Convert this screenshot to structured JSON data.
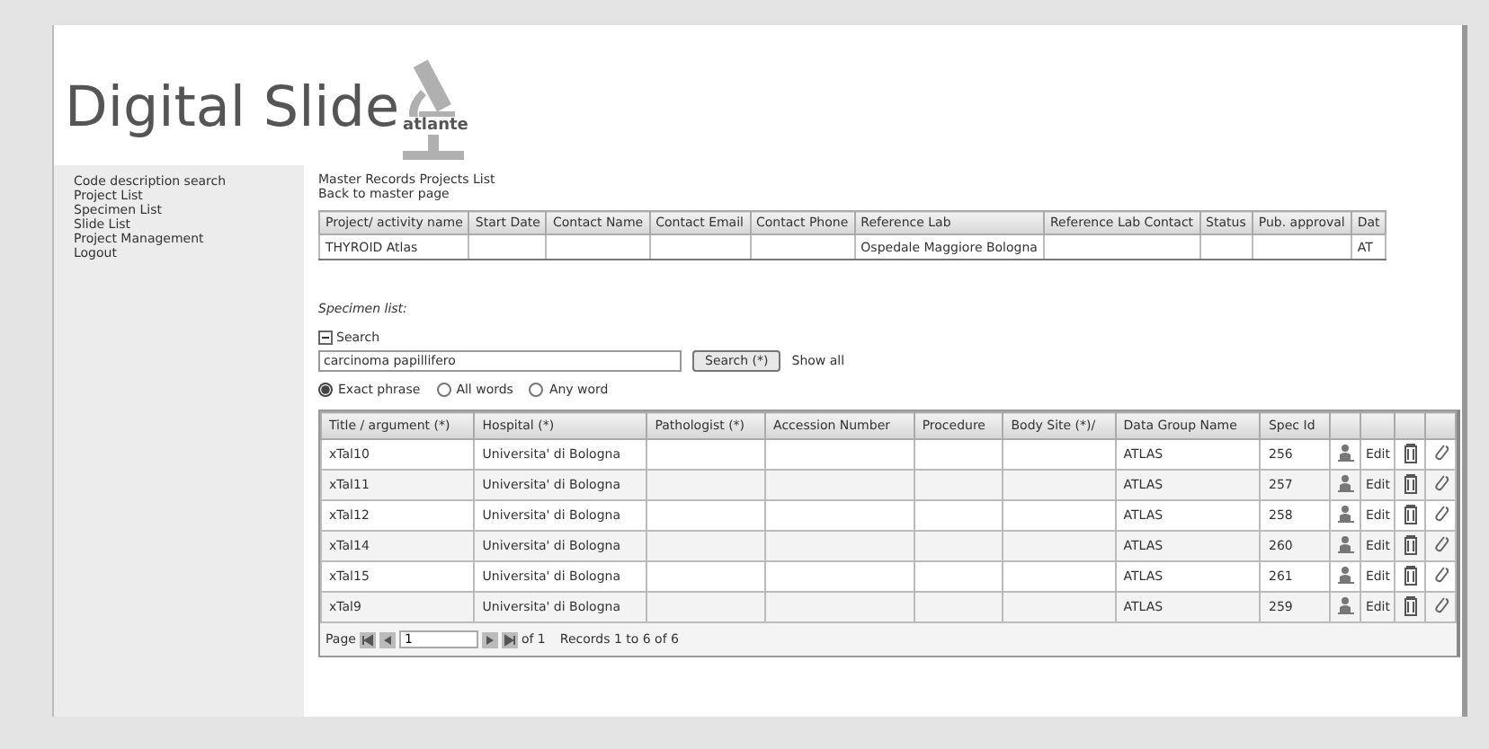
{
  "logo": {
    "title": "Digital Slide",
    "subtitle": "atlante"
  },
  "nav": [
    {
      "label": "Code description search"
    },
    {
      "label": "Project List"
    },
    {
      "label": "Specimen List"
    },
    {
      "label": "Slide List"
    },
    {
      "label": "Project Management"
    },
    {
      "label": "Logout"
    }
  ],
  "master": {
    "title": "Master Records Projects List",
    "back_link": "Back to master page",
    "columns": [
      "Project/ activity name",
      "Start Date",
      "Contact Name",
      "Contact Email",
      "Contact Phone",
      "Reference Lab",
      "Reference Lab Contact",
      "Status",
      "Pub. approval",
      "Dat"
    ],
    "rows": [
      [
        "THYROID Atlas",
        "",
        "",
        "",
        "",
        "Ospedale Maggiore Bologna",
        "",
        "",
        "",
        "AT"
      ]
    ]
  },
  "specimens": {
    "title": "Specimen list:",
    "search": {
      "label": "Search",
      "expanded": true,
      "value": "carcinoma papillifero",
      "button": "Search (*)",
      "show_all": "Show all",
      "options": [
        {
          "label": "Exact phrase",
          "selected": true
        },
        {
          "label": "All words",
          "selected": false
        },
        {
          "label": "Any word",
          "selected": false
        }
      ]
    },
    "columns": [
      "Title / argument (*)",
      "Hospital (*)",
      "Pathologist (*)",
      "Accession Number",
      "Procedure",
      "Body Site (*)/",
      "Data Group Name",
      "Spec Id"
    ],
    "rows": [
      {
        "cells": [
          "xTal10",
          "Universita' di Bologna",
          "",
          "",
          "",
          "",
          "ATLAS",
          "256"
        ],
        "edit": "Edit"
      },
      {
        "cells": [
          "xTal11",
          "Universita' di Bologna",
          "",
          "",
          "",
          "",
          "ATLAS",
          "257"
        ],
        "edit": "Edit"
      },
      {
        "cells": [
          "xTal12",
          "Universita' di Bologna",
          "",
          "",
          "",
          "",
          "ATLAS",
          "258"
        ],
        "edit": "Edit"
      },
      {
        "cells": [
          "xTal14",
          "Universita' di Bologna",
          "",
          "",
          "",
          "",
          "ATLAS",
          "260"
        ],
        "edit": "Edit"
      },
      {
        "cells": [
          "xTal15",
          "Universita' di Bologna",
          "",
          "",
          "",
          "",
          "ATLAS",
          "261"
        ],
        "edit": "Edit"
      },
      {
        "cells": [
          "xTal9",
          "Universita' di Bologna",
          "",
          "",
          "",
          "",
          "ATLAS",
          "259"
        ],
        "edit": "Edit"
      }
    ],
    "pager": {
      "label": "Page",
      "page": "1",
      "of": "of 1",
      "records": "Records 1 to 6 of 6"
    }
  }
}
